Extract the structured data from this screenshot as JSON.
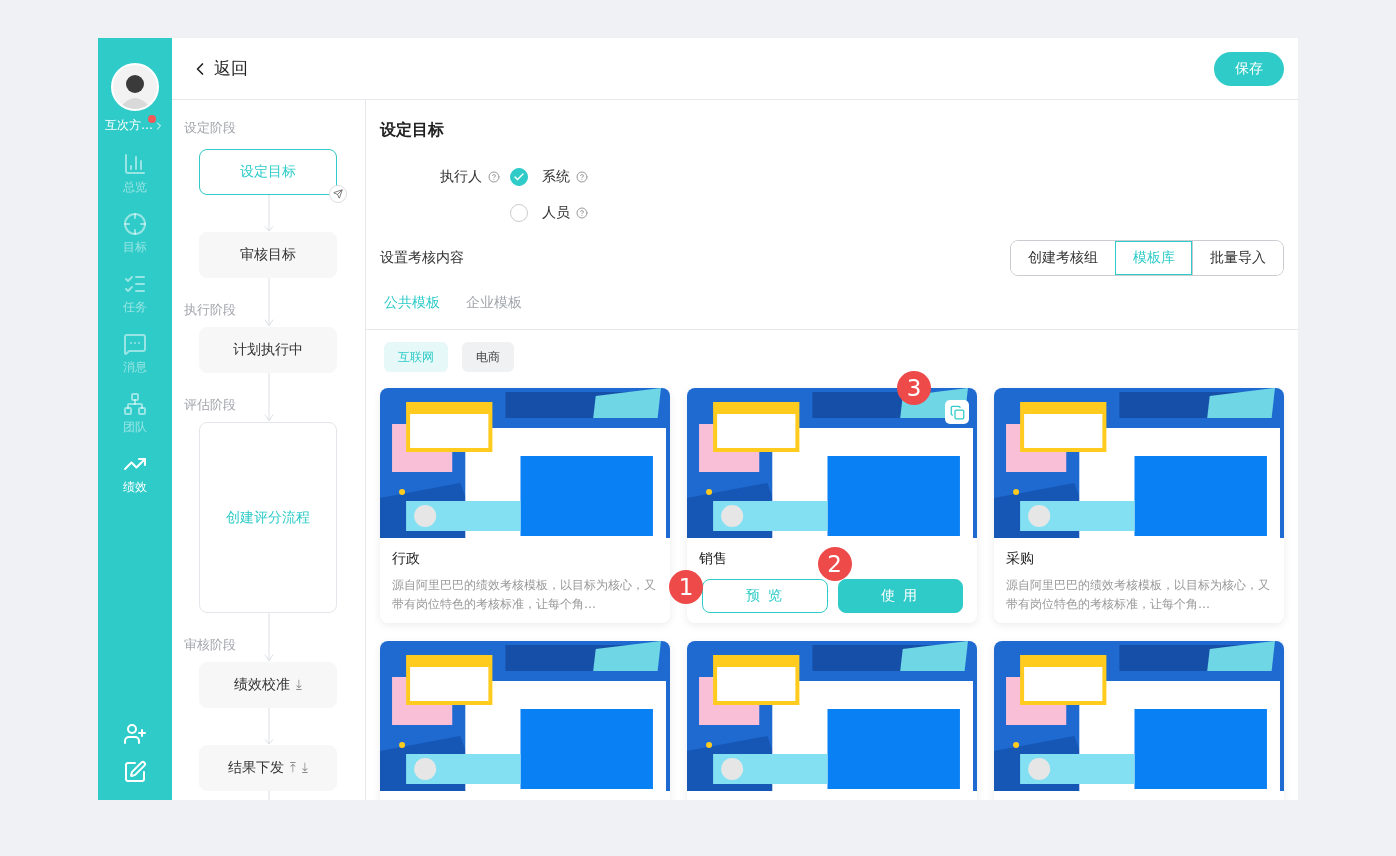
{
  "sidebar": {
    "user": {
      "name": "互次方…",
      "notification": true
    },
    "items": [
      {
        "label": "总览",
        "selected": false
      },
      {
        "label": "目标",
        "selected": false
      },
      {
        "label": "任务",
        "selected": false
      },
      {
        "label": "消息",
        "selected": false
      },
      {
        "label": "团队",
        "selected": false
      },
      {
        "label": "绩效",
        "selected": true
      }
    ]
  },
  "header": {
    "back": "返回",
    "save": "保存"
  },
  "flow": {
    "stages": [
      {
        "label": "设定阶段",
        "steps": [
          {
            "label": "设定目标",
            "kind": "step",
            "selected": true
          },
          {
            "label": "审核目标",
            "kind": "step",
            "selected": false
          }
        ]
      },
      {
        "label": "执行阶段",
        "steps": [
          {
            "label": "计划执行中",
            "kind": "step",
            "selected": false
          }
        ]
      },
      {
        "label": "评估阶段",
        "steps": [
          {
            "label": "创建评分流程",
            "kind": "create",
            "selected": false
          }
        ]
      },
      {
        "label": "审核阶段",
        "steps": [
          {
            "label": "绩效校准",
            "kind": "step",
            "selected": false,
            "marks": [
              "⤓"
            ]
          },
          {
            "label": "结果下发",
            "kind": "step",
            "selected": false,
            "marks": [
              "⤒",
              "⤓"
            ]
          }
        ]
      }
    ]
  },
  "main": {
    "title": "设定目标",
    "executor": {
      "label": "执行人",
      "options": [
        {
          "label": "系统",
          "selected": true
        },
        {
          "label": "人员",
          "selected": false
        }
      ]
    },
    "content": {
      "label": "设置考核内容",
      "modes": [
        {
          "label": "创建考核组",
          "selected": false
        },
        {
          "label": "模板库",
          "selected": true
        },
        {
          "label": "批量导入",
          "selected": false
        }
      ]
    },
    "tabs": [
      {
        "label": "公共模板",
        "selected": true
      },
      {
        "label": "企业模板",
        "selected": false
      }
    ],
    "filters": [
      {
        "label": "互联网",
        "selected": true
      },
      {
        "label": "电商",
        "selected": false
      }
    ],
    "cards": [
      {
        "title": "行政",
        "description": "源自阿里巴巴的绩效考核模板，以目标为核心，又带有岗位特色的考核标准，让每个角…",
        "hovered": false
      },
      {
        "title": "销售",
        "hovered": true,
        "corner_badge": "3",
        "actions": [
          {
            "label": "预 览",
            "kind": "outline",
            "badge": "1"
          },
          {
            "label": "使 用",
            "kind": "filled",
            "badge": "2"
          }
        ]
      },
      {
        "title": "采购",
        "description": "源自阿里巴巴的绩效考核模板，以目标为核心，又带有岗位特色的考核标准，让每个角…",
        "hovered": false
      },
      {
        "hovered": false
      },
      {
        "hovered": false
      },
      {
        "hovered": false
      }
    ]
  }
}
